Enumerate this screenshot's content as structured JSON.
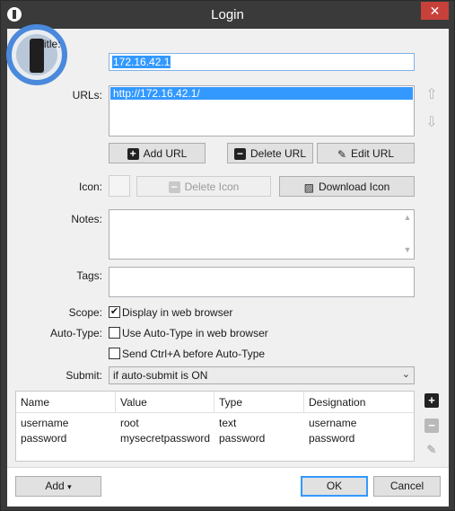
{
  "window": {
    "title": "Login",
    "close_glyph": "✕"
  },
  "form": {
    "title_label": "Title:",
    "title_value": "172.16.42.1",
    "urls_label": "URLs:",
    "urls": [
      "http://172.16.42.1/"
    ],
    "add_url": "Add URL",
    "delete_url": "Delete URL",
    "edit_url": "Edit URL",
    "icon_label": "Icon:",
    "delete_icon": "Delete Icon",
    "download_icon": "Download Icon",
    "notes_label": "Notes:",
    "notes_value": "",
    "tags_label": "Tags:",
    "tags_value": "",
    "scope_label": "Scope:",
    "scope_option": "Display in web browser",
    "scope_checked": true,
    "autotype_label": "Auto-Type:",
    "autotype_option": "Use Auto-Type in web browser",
    "autotype_checked": false,
    "ctrl_a_option": "Send Ctrl+A before Auto-Type",
    "ctrl_a_checked": false,
    "submit_label": "Submit:",
    "submit_value": "if auto-submit is ON"
  },
  "fields_table": {
    "headers": [
      "Name",
      "Value",
      "Type",
      "Designation"
    ],
    "rows": [
      [
        "username",
        "root",
        "text",
        "username"
      ],
      [
        "password",
        "mysecretpassword",
        "password",
        "password"
      ]
    ]
  },
  "footer": {
    "add": "Add",
    "ok": "OK",
    "cancel": "Cancel"
  },
  "icons": {
    "move_up": "arrow-up-icon",
    "move_down": "arrow-down-icon",
    "plus": "plus-icon",
    "minus": "minus-icon",
    "edit": "pencil-icon"
  },
  "colors": {
    "selection": "#3399ff",
    "titlebar": "#3a3a3a",
    "close": "#c7413a"
  }
}
